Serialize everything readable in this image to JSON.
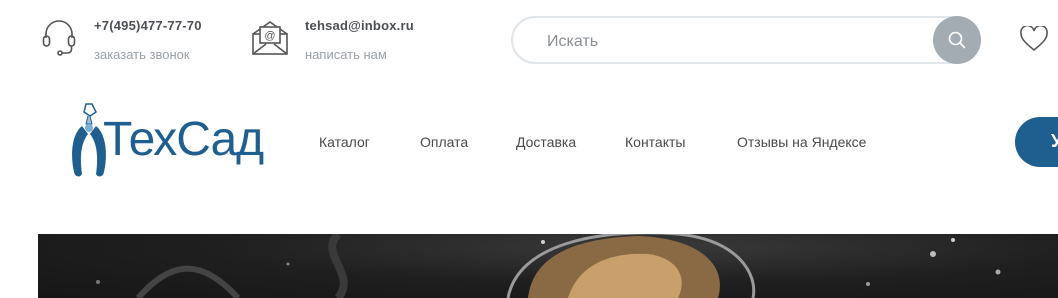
{
  "contacts": {
    "phone": {
      "number": "+7(495)477-77-70",
      "action": "заказать звонок",
      "icon": "headset-icon"
    },
    "email": {
      "address": "tehsad@inbox.ru",
      "action": "написать нам",
      "icon": "envelope-icon"
    }
  },
  "search": {
    "placeholder": "Искать",
    "icon": "search-icon"
  },
  "favorites": {
    "icon": "heart-icon"
  },
  "logo": {
    "text": "ТехСад"
  },
  "nav": {
    "items": [
      {
        "label": "Каталог"
      },
      {
        "label": "Оплата"
      },
      {
        "label": "Доставка"
      },
      {
        "label": "Контакты"
      },
      {
        "label": "Отзывы на Яндексе"
      }
    ]
  },
  "cta": {
    "label": "У"
  },
  "colors": {
    "brand": "#1e5f8f",
    "search_button": "#a3acb3",
    "text": "#4a4a4a",
    "muted": "#9aa0a6"
  }
}
